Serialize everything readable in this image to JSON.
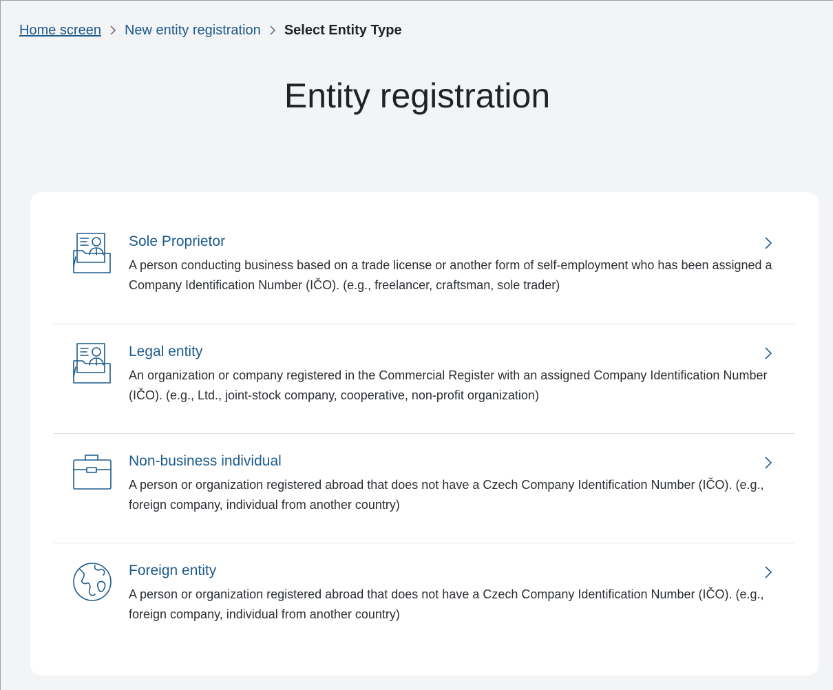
{
  "breadcrumb": {
    "home": "Home screen",
    "registration": "New entity registration",
    "current": "Select Entity Type"
  },
  "page": {
    "title": "Entity registration"
  },
  "options": [
    {
      "title": "Sole Proprietor",
      "description": "A person conducting business based on a trade license or another form of self-employment who has been assigned a Company Identification Number (IČO). (e.g., freelancer, craftsman, sole trader)",
      "icon": "person-folder-icon"
    },
    {
      "title": "Legal entity",
      "description": "An organization or company registered in the Commercial Register with an assigned Company Identification Number (IČO). (e.g., Ltd., joint-stock company, cooperative, non-profit organization)",
      "icon": "person-folder-icon"
    },
    {
      "title": "Non-business individual",
      "description": "A person or organization registered abroad that does not have a Czech Company Identification Number (IČO). (e.g., foreign company, individual from another country)",
      "icon": "briefcase-icon"
    },
    {
      "title": "Foreign entity",
      "description": "A person or organization registered abroad that does not have a Czech Company Identification Number (IČO). (e.g., foreign company, individual from another country)",
      "icon": "globe-icon"
    }
  ],
  "colors": {
    "accent": "#1c5a8c",
    "background": "#f3f4f6",
    "card": "#ffffff",
    "divider": "#dfe1e5"
  }
}
